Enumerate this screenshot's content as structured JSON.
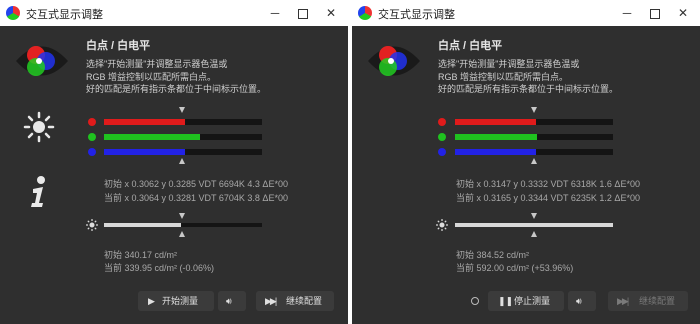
{
  "windows": [
    {
      "title": "交互式显示调整",
      "heading": "白点 / 白电平",
      "description": [
        "选择\"开始测量\"并调整显示器色温或",
        "RGB 增益控制以匹配所需白点。",
        "好的匹配是所有指示条都位于中间标示位置。"
      ],
      "bars": [
        {
          "name": "red",
          "color": "#e01b1b",
          "level": 0.51
        },
        {
          "name": "green",
          "color": "#1fc21f",
          "level": 0.61
        },
        {
          "name": "blue",
          "color": "#2222e6",
          "level": 0.51
        }
      ],
      "initial_line": "初始 x 0.3062 y 0.3285 VDT 6694K 4.3 ΔE*00",
      "current_line": "当前 x 0.3064 y 0.3281 VDT 6704K 3.8 ΔE*00",
      "luminance_level": 0.49,
      "lum_initial": "初始 340.17 cd/m²",
      "lum_current": "当前 339.95 cd/m² (-0.06%)",
      "buttons": {
        "start": {
          "label": "开始测量",
          "icon": "play-icon"
        },
        "sound": {
          "icon": "speaker-icon"
        },
        "continue": {
          "label": "继续配置",
          "icon": "skip-forward-icon"
        }
      }
    },
    {
      "title": "交互式显示调整",
      "heading": "白点 / 白电平",
      "description": [
        "选择\"开始测量\"并调整显示器色温或",
        "RGB 增益控制以匹配所需白点。",
        "好的匹配是所有指示条都位于中间标示位置。"
      ],
      "bars": [
        {
          "name": "red",
          "color": "#e01b1b",
          "level": 0.51
        },
        {
          "name": "green",
          "color": "#1fc21f",
          "level": 0.52
        },
        {
          "name": "blue",
          "color": "#2222e6",
          "level": 0.51
        }
      ],
      "initial_line": "初始 x 0.3147 y 0.3332 VDT 6318K 1.6 ΔE*00",
      "current_line": "当前 x 0.3165 y 0.3344 VDT 6235K 1.2 ΔE*00",
      "luminance_level": 1.0,
      "lum_initial": "初始 384.52 cd/m²",
      "lum_current": "当前 592.00 cd/m² (+53.96%)",
      "buttons": {
        "stop": {
          "label": "停止测量",
          "icon": "pause-icon"
        },
        "sound": {
          "icon": "speaker-icon"
        },
        "continue": {
          "label": "继续配置",
          "icon": "skip-forward-icon",
          "disabled": true
        }
      }
    }
  ]
}
